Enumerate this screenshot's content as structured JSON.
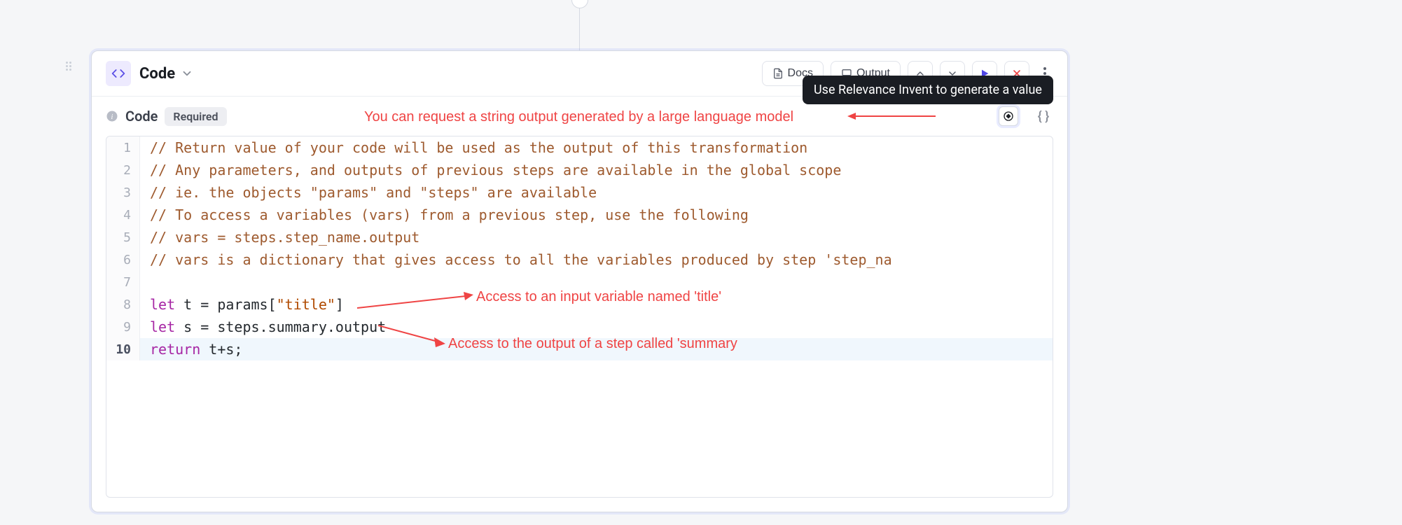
{
  "connector": {
    "present": true
  },
  "header": {
    "title": "Code",
    "docs_label": "Docs",
    "output_label": "Output"
  },
  "section": {
    "label": "Code",
    "required_label": "Required",
    "braces_label": "{ }"
  },
  "tooltip": {
    "text": "Use Relevance Invent to generate a value"
  },
  "annotations": {
    "top": "You can request a string output generated by a large language model",
    "mid": "Access to an input variable named 'title'",
    "bottom": "Access to the output of a step called 'summary"
  },
  "editor": {
    "lines": [
      {
        "n": 1,
        "type": "comment",
        "text": "// Return value of your code will be used as the output of this transformation"
      },
      {
        "n": 2,
        "type": "comment",
        "text": "// Any parameters, and outputs of previous steps are available in the global scope"
      },
      {
        "n": 3,
        "type": "comment",
        "text": "// ie. the objects \"params\" and \"steps\" are available"
      },
      {
        "n": 4,
        "type": "comment",
        "text": "// To access a variables (vars) from a previous step, use the following"
      },
      {
        "n": 5,
        "type": "comment",
        "text": "// vars = steps.step_name.output"
      },
      {
        "n": 6,
        "type": "comment",
        "text": "// vars is a dictionary that gives access to all the variables produced by step 'step_na"
      },
      {
        "n": 7,
        "type": "blank",
        "text": ""
      },
      {
        "n": 8,
        "type": "code",
        "kw": "let",
        "var": " t = params[",
        "str": "\"title\"",
        "tail": "]"
      },
      {
        "n": 9,
        "type": "code",
        "kw": "let",
        "var": " s = steps.summary.output",
        "str": "",
        "tail": ""
      },
      {
        "n": 10,
        "type": "code",
        "kw": "return",
        "var": " t+s;",
        "str": "",
        "tail": "",
        "active": true
      }
    ]
  }
}
